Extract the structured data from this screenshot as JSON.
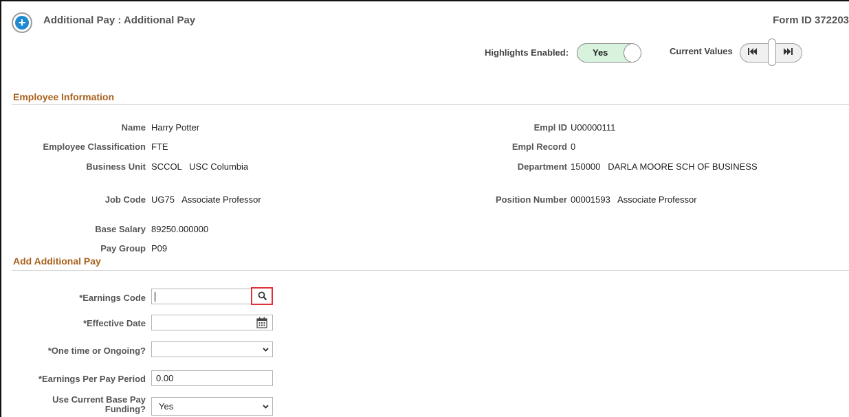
{
  "header": {
    "title": "Additional Pay : Additional Pay",
    "form_id": "Form ID 372203",
    "add_icon": "plus-circle-icon",
    "highlights_label": "Highlights Enabled:",
    "highlights_value": "Yes",
    "current_values_label": "Current Values",
    "current_values_first": "|◀◀",
    "current_values_last": "▶▶|"
  },
  "employee_info": {
    "section_title": "Employee Information",
    "left": [
      {
        "label": "Name",
        "value": "Harry Potter"
      },
      {
        "label": "Employee Classification",
        "value": "FTE"
      },
      {
        "label": "Business Unit",
        "value": "SCCOL   USC Columbia"
      },
      {
        "label": "Job Code",
        "value": "UG75   Associate Professor"
      },
      {
        "label": "Base Salary",
        "value": "89250.000000"
      },
      {
        "label": "Pay Group",
        "value": "P09"
      }
    ],
    "right": [
      {
        "label": "Empl ID",
        "value": "U00000111"
      },
      {
        "label": "Empl Record",
        "value": "0"
      },
      {
        "label": "Department",
        "value": "150000   DARLA MOORE SCH OF BUSINESS"
      },
      {
        "label": "Position Number",
        "value": "00001593   Associate Professor"
      }
    ]
  },
  "add_pay": {
    "section_title": "Add Additional Pay",
    "earnings_code_label": "*Earnings Code",
    "earnings_code_value": "",
    "lookup_icon": "search-icon",
    "effective_date_label": "*Effective Date",
    "effective_date_value": "",
    "calendar_icon": "calendar-icon",
    "one_time_label": "*One time or Ongoing?",
    "one_time_value": "",
    "earnings_per_period_label": "*Earnings Per Pay Period",
    "earnings_per_period_value": "0.00",
    "use_base_funding_label_1": "Use Current Base Pay",
    "use_base_funding_label_2": "Funding?",
    "use_base_funding_value": "Yes"
  },
  "colors": {
    "section_title": "#a8611c",
    "toggle_on": "#d8f3dd",
    "lookup_highlight": "#e0313a",
    "accent_blue": "#1f8ad1"
  }
}
